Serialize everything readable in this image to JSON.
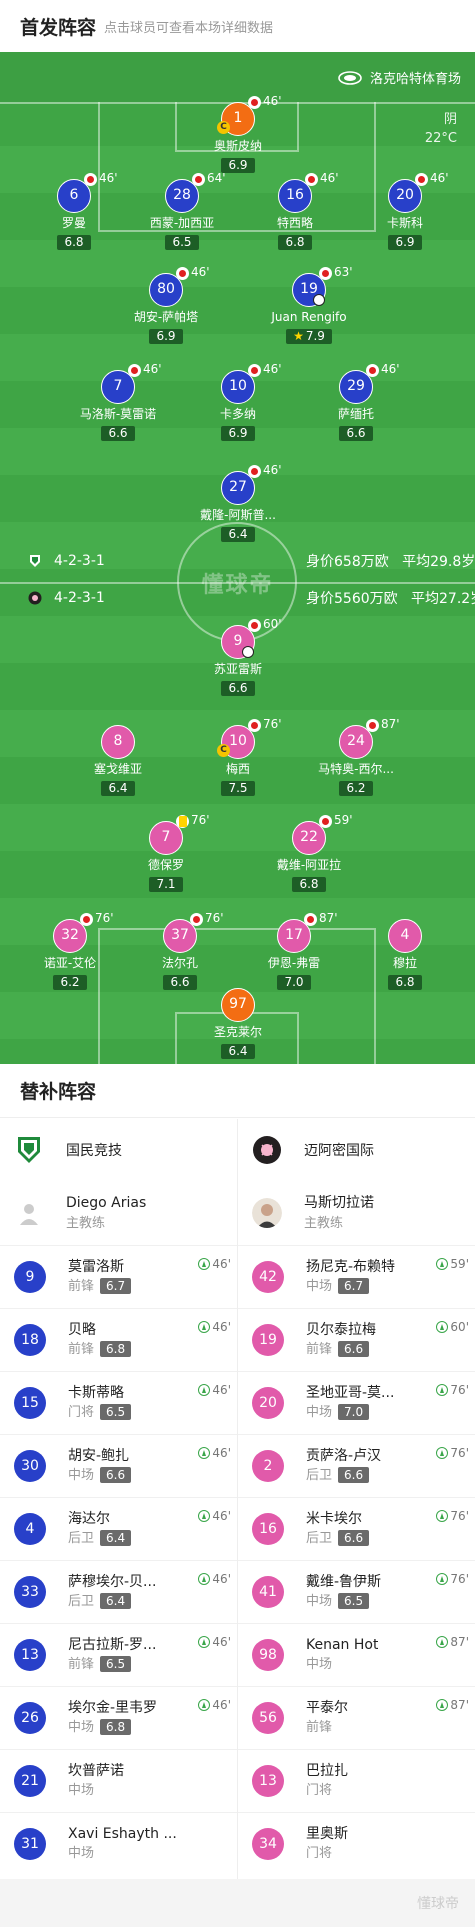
{
  "header": {
    "title": "首发阵容",
    "subtitle": "点击球员可查看本场详细数据"
  },
  "venue": "洛克哈特体育场",
  "weather": {
    "condition": "阴",
    "temperature": "22°C"
  },
  "watermark": "懂球帝",
  "home_summary": {
    "formation": "4-2-3-1",
    "value": "身价658万欧",
    "age": "平均29.8岁"
  },
  "away_summary": {
    "formation": "4-2-3-1",
    "value": "身价5560万欧",
    "age": "平均27.2岁"
  },
  "colors": {
    "home": "#2840c9",
    "away": "#e15aaa",
    "goalkeeper": "#f36d13",
    "pitch": "#46ad4c"
  },
  "home_players": [
    {
      "num": "1",
      "name": "奥斯皮纳",
      "rating": "6.9",
      "sub": "46'",
      "captain": true,
      "gk": true
    },
    {
      "num": "6",
      "name": "罗曼",
      "rating": "6.8",
      "sub": "46'"
    },
    {
      "num": "28",
      "name": "西蒙-加西亚",
      "rating": "6.5",
      "sub": "64'"
    },
    {
      "num": "16",
      "name": "特西略",
      "rating": "6.8",
      "sub": "46'"
    },
    {
      "num": "20",
      "name": "卡斯科",
      "rating": "6.9",
      "sub": "46'"
    },
    {
      "num": "80",
      "name": "胡安-萨帕塔",
      "rating": "6.9",
      "sub": "46'"
    },
    {
      "num": "19",
      "name": "Juan Rengifo",
      "rating": "7.9",
      "sub": "63'",
      "goal": true,
      "star": true
    },
    {
      "num": "7",
      "name": "马洛斯-莫雷诺",
      "rating": "6.6",
      "sub": "46'"
    },
    {
      "num": "10",
      "name": "卡多纳",
      "rating": "6.9",
      "sub": "46'"
    },
    {
      "num": "29",
      "name": "萨缅托",
      "rating": "6.6",
      "sub": "46'"
    },
    {
      "num": "27",
      "name": "戴隆-阿斯普...",
      "rating": "6.4",
      "sub": "46'"
    }
  ],
  "away_players": [
    {
      "num": "9",
      "name": "苏亚雷斯",
      "rating": "6.6",
      "sub": "60'",
      "goal": true
    },
    {
      "num": "8",
      "name": "塞戈维亚",
      "rating": "6.4"
    },
    {
      "num": "10",
      "name": "梅西",
      "rating": "7.5",
      "sub": "76'",
      "captain": true
    },
    {
      "num": "24",
      "name": "马特奥-西尔...",
      "rating": "6.2",
      "sub": "87'"
    },
    {
      "num": "7",
      "name": "德保罗",
      "rating": "7.1",
      "sub": "76'",
      "yellow": true
    },
    {
      "num": "22",
      "name": "戴维-阿亚拉",
      "rating": "6.8",
      "sub": "59'"
    },
    {
      "num": "32",
      "name": "诺亚-艾伦",
      "rating": "6.2",
      "sub": "76'"
    },
    {
      "num": "37",
      "name": "法尔孔",
      "rating": "6.6",
      "sub": "76'"
    },
    {
      "num": "17",
      "name": "伊恩-弗雷",
      "rating": "7.0",
      "sub": "87'"
    },
    {
      "num": "4",
      "name": "穆拉",
      "rating": "6.8"
    },
    {
      "num": "97",
      "name": "圣克莱尔",
      "rating": "6.4",
      "gk": true
    }
  ],
  "subs": {
    "title": "替补阵容",
    "home": {
      "team": "国民竞技",
      "coach": {
        "name": "Diego Arias",
        "role": "主教练"
      },
      "players": [
        {
          "num": "9",
          "name": "莫雷洛斯",
          "pos": "前锋",
          "rating": "6.7",
          "in": "46'"
        },
        {
          "num": "18",
          "name": "贝略",
          "pos": "前锋",
          "rating": "6.8",
          "in": "46'"
        },
        {
          "num": "15",
          "name": "卡斯蒂略",
          "pos": "门将",
          "rating": "6.5",
          "in": "46'"
        },
        {
          "num": "30",
          "name": "胡安-鲍扎",
          "pos": "中场",
          "rating": "6.6",
          "in": "46'"
        },
        {
          "num": "4",
          "name": "海达尔",
          "pos": "后卫",
          "rating": "6.4",
          "in": "46'"
        },
        {
          "num": "33",
          "name": "萨穆埃尔-贝...",
          "pos": "后卫",
          "rating": "6.4",
          "in": "46'"
        },
        {
          "num": "13",
          "name": "尼古拉斯-罗...",
          "pos": "前锋",
          "rating": "6.5",
          "in": "46'"
        },
        {
          "num": "26",
          "name": "埃尔金-里韦罗",
          "pos": "中场",
          "rating": "6.8",
          "in": "46'"
        },
        {
          "num": "21",
          "name": "坎普萨诺",
          "pos": "中场"
        },
        {
          "num": "31",
          "name": "Xavi Eshayth ...",
          "pos": "中场"
        }
      ]
    },
    "away": {
      "team": "迈阿密国际",
      "coach": {
        "name": "马斯切拉诺",
        "role": "主教练"
      },
      "players": [
        {
          "num": "42",
          "name": "扬尼克-布赖特",
          "pos": "中场",
          "rating": "6.7",
          "in": "59'"
        },
        {
          "num": "19",
          "name": "贝尔泰拉梅",
          "pos": "前锋",
          "rating": "6.6",
          "in": "60'"
        },
        {
          "num": "20",
          "name": "圣地亚哥-莫...",
          "pos": "中场",
          "rating": "7.0",
          "in": "76'"
        },
        {
          "num": "2",
          "name": "贡萨洛-卢汉",
          "pos": "后卫",
          "rating": "6.6",
          "in": "76'"
        },
        {
          "num": "16",
          "name": "米卡埃尔",
          "pos": "后卫",
          "rating": "6.6",
          "in": "76'"
        },
        {
          "num": "41",
          "name": "戴维-鲁伊斯",
          "pos": "中场",
          "rating": "6.5",
          "in": "76'"
        },
        {
          "num": "98",
          "name": "Kenan Hot",
          "pos": "中场",
          "in": "87'"
        },
        {
          "num": "56",
          "name": "平泰尔",
          "pos": "前锋",
          "in": "87'"
        },
        {
          "num": "13",
          "name": "巴拉扎",
          "pos": "门将"
        },
        {
          "num": "34",
          "name": "里奥斯",
          "pos": "门将"
        }
      ]
    }
  },
  "footer_watermark": "懂球帝"
}
